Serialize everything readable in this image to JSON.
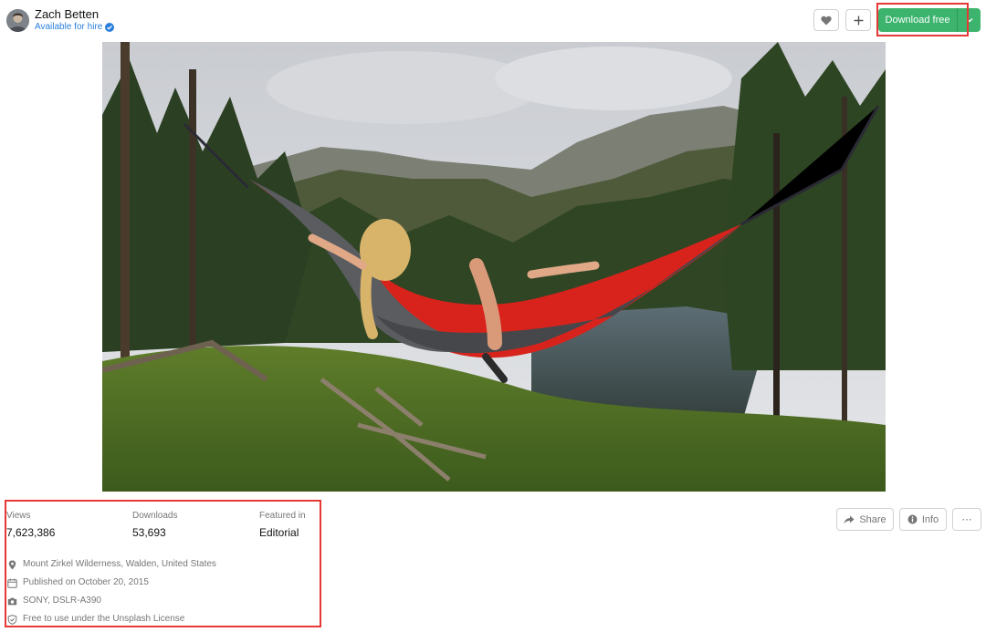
{
  "author": {
    "name": "Zach Betten",
    "status": "Available for hire",
    "avatar_icon": "avatar-icon",
    "verified_icon": "verified-badge-icon"
  },
  "toolbar": {
    "like_icon": "heart-icon",
    "collect_icon": "plus-icon",
    "download_label": "Download free",
    "download_options_icon": "chevron-down-icon",
    "download_color": "#3cb46e"
  },
  "photo": {
    "subject": "hammock-photo"
  },
  "stats": {
    "views_label": "Views",
    "views_value": "7,623,386",
    "downloads_label": "Downloads",
    "downloads_value": "53,693",
    "featured_label": "Featured in",
    "featured_value": "Editorial"
  },
  "meta": {
    "location": "Mount Zirkel Wilderness, Walden, United States",
    "published": "Published on October 20, 2015",
    "camera": "SONY, DSLR-A390",
    "license": "Free to use under the Unsplash License"
  },
  "actions": {
    "share_label": "Share",
    "info_label": "Info",
    "more_label": "⋯"
  },
  "annotation": {
    "highlight_color": "#e53935"
  }
}
